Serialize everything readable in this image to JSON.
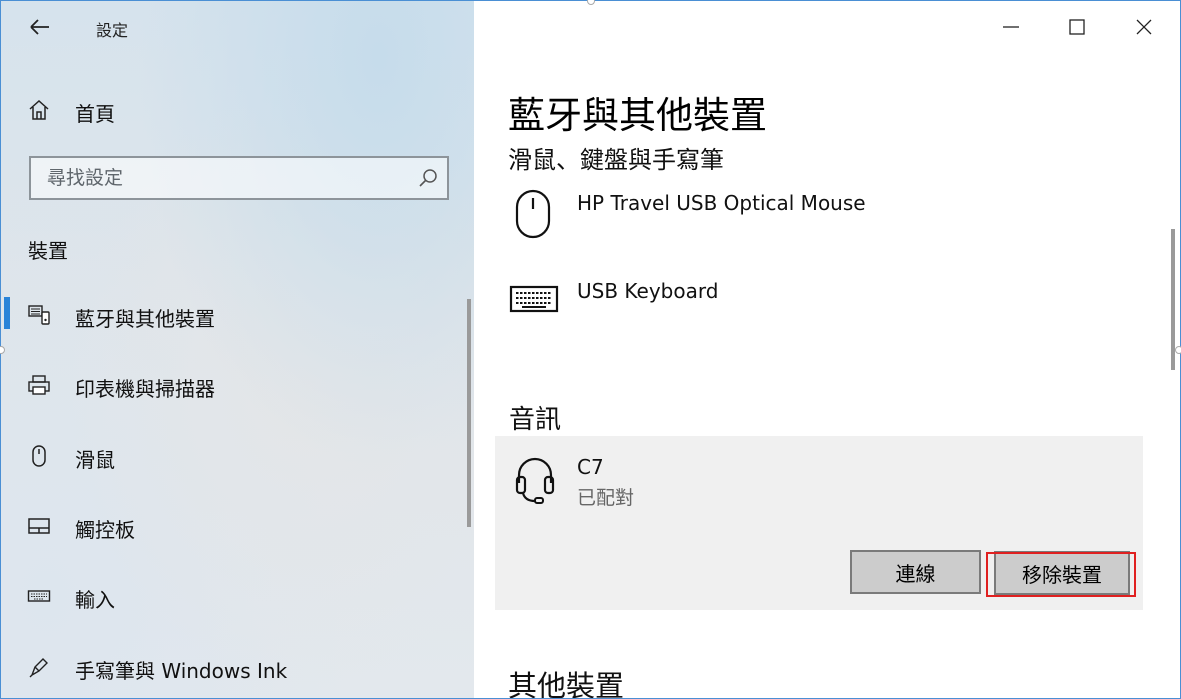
{
  "window": {
    "app_title": "設定",
    "controls": {
      "minimize": "minimize-icon",
      "maximize": "maximize-icon",
      "close": "close-icon"
    }
  },
  "sidebar": {
    "home_label": "首頁",
    "search": {
      "placeholder": "尋找設定"
    },
    "section_label": "裝置",
    "items": [
      {
        "label": "藍牙與其他裝置",
        "icon": "bluetooth-devices-icon",
        "active": true
      },
      {
        "label": "印表機與掃描器",
        "icon": "printer-icon",
        "active": false
      },
      {
        "label": "滑鼠",
        "icon": "mouse-icon",
        "active": false
      },
      {
        "label": "觸控板",
        "icon": "touchpad-icon",
        "active": false
      },
      {
        "label": "輸入",
        "icon": "keyboard-icon",
        "active": false
      },
      {
        "label": "手寫筆與 Windows Ink",
        "icon": "pen-icon",
        "active": false
      }
    ],
    "accent_color": "#2a84d8"
  },
  "main": {
    "title": "藍牙與其他裝置",
    "input_section": {
      "heading": "滑鼠、鍵盤與手寫筆",
      "devices": [
        {
          "name": "HP Travel USB Optical Mouse",
          "icon": "mouse-icon"
        },
        {
          "name": "USB Keyboard",
          "icon": "keyboard-icon"
        }
      ]
    },
    "audio_section": {
      "heading": "音訊",
      "device": {
        "name": "C7",
        "status": "已配對",
        "icon": "headset-icon"
      },
      "connect_label": "連線",
      "remove_label": "移除裝置"
    },
    "other_section": {
      "heading": "其他裝置"
    }
  },
  "highlight_color": "#e02020"
}
